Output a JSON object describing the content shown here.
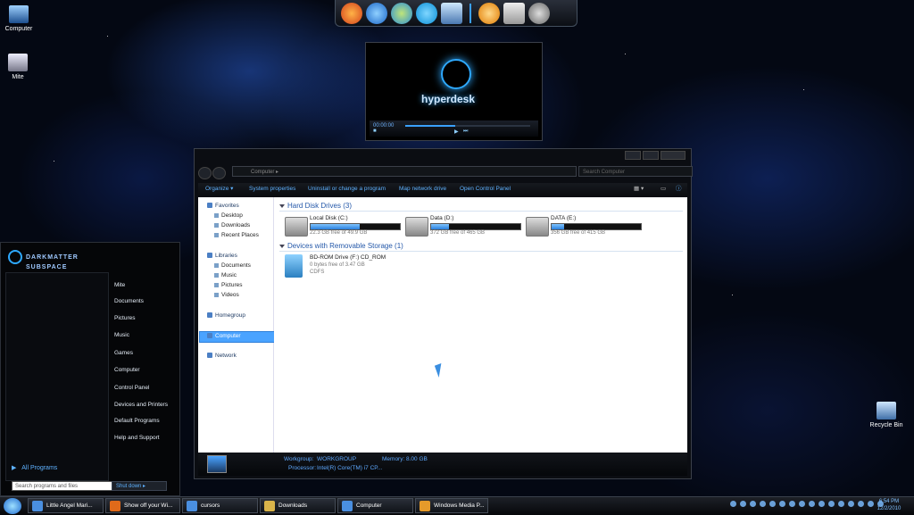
{
  "desktop": {
    "icons": [
      {
        "label": "Computer"
      },
      {
        "label": "Mite"
      },
      {
        "label": "Recycle Bin"
      }
    ]
  },
  "dock": {
    "icons": [
      "firefox-icon",
      "ie-icon",
      "messenger-icon",
      "skype-icon",
      "display-icon",
      "winamp-icon",
      "media-player-classic-icon",
      "mve-icon"
    ]
  },
  "media_gadget": {
    "brand": "hyperdesk",
    "time": "00:00:00"
  },
  "explorer": {
    "address": "Computer",
    "search_placeholder": "Search Computer",
    "commands": [
      "Organize",
      "System properties",
      "Uninstall or change a program",
      "Map network drive",
      "Open Control Panel"
    ],
    "nav": {
      "favorites": {
        "label": "Favorites",
        "items": [
          "Desktop",
          "Downloads",
          "Recent Places"
        ]
      },
      "libraries": {
        "label": "Libraries",
        "items": [
          "Documents",
          "Music",
          "Pictures",
          "Videos"
        ]
      },
      "homegroup": "Homegroup",
      "computer": "Computer",
      "network": "Network"
    },
    "groups": {
      "hdd": "Hard Disk Drives (3)",
      "removable": "Devices with Removable Storage (1)"
    },
    "drives": [
      {
        "name": "Local Disk (C:)",
        "free": "22.3 GB free of 49.9 GB",
        "used_fraction": 0.55
      },
      {
        "name": "Data (D:)",
        "free": "372 GB free of 465 GB",
        "used_fraction": 0.2
      },
      {
        "name": "DATA (E:)",
        "free": "356 GB free of 415 GB",
        "used_fraction": 0.14
      }
    ],
    "bd_drive": {
      "name": "BD-ROM Drive (F:) CD_ROM",
      "free": "0 bytes free of 3.47 GB",
      "fs": "CDFS"
    },
    "details": {
      "workgroup_label": "Workgroup:",
      "workgroup": "WORKGROUP",
      "memory_label": "Memory:",
      "memory": "8.00 GB",
      "processor_label": "Processor:",
      "processor": "Intel(R) Core(TM) i7 CP..."
    }
  },
  "start_menu": {
    "brand_line1": "DARKMATTER",
    "brand_line2": "SUBSPACE",
    "right_items": [
      "Mite",
      "Documents",
      "Pictures",
      "Music",
      "Games",
      "Computer",
      "Control Panel",
      "Devices and Printers",
      "Default Programs",
      "Help and Support"
    ],
    "all_programs": "All Programs",
    "search_placeholder": "Search programs and files",
    "shutdown": "Shut down"
  },
  "taskbar": {
    "tasks": [
      "Little Angel Mari...",
      "Show off your Wi...",
      "cursors",
      "Downloads",
      "Computer",
      "Windows Media P..."
    ],
    "time": "6:54 PM",
    "date": "12/2/2010"
  }
}
